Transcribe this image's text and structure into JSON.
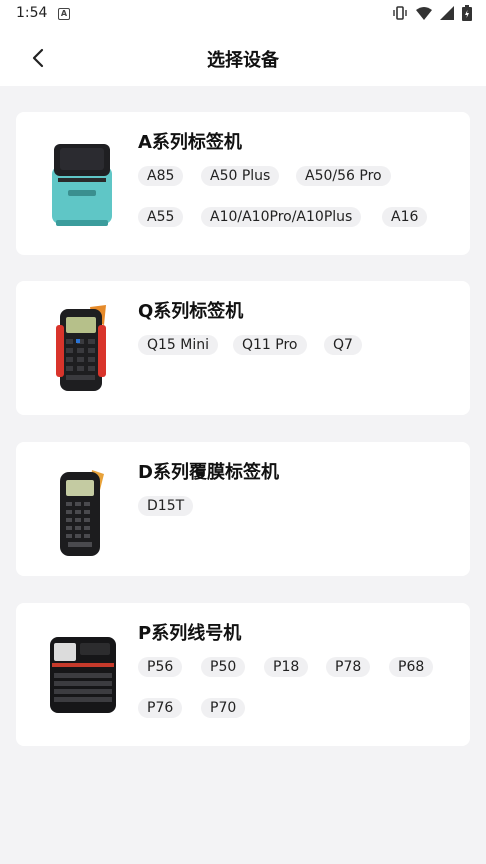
{
  "status_bar": {
    "time": "1:54",
    "app_badge": "A"
  },
  "header": {
    "title": "选择设备"
  },
  "colors": {
    "background": "#f3f3f5",
    "card": "#ffffff",
    "tag_bg": "#f0f0f2"
  },
  "series": [
    {
      "name": "A系列标签机",
      "icon": "a-series-printer-image",
      "models": [
        "A85",
        "A50 Plus",
        "A50/56 Pro",
        "A55",
        "A10/A10Pro/A10Plus",
        "A16"
      ]
    },
    {
      "name": "Q系列标签机",
      "icon": "q-series-printer-image",
      "models": [
        "Q15 Mini",
        "Q11 Pro",
        "Q7"
      ]
    },
    {
      "name": "D系列覆膜标签机",
      "icon": "d-series-printer-image",
      "models": [
        "D15T"
      ]
    },
    {
      "name": "P系列线号机",
      "icon": "p-series-printer-image",
      "models": [
        "P56",
        "P50",
        "P18",
        "P78",
        "P68",
        "P76",
        "P70"
      ]
    }
  ]
}
